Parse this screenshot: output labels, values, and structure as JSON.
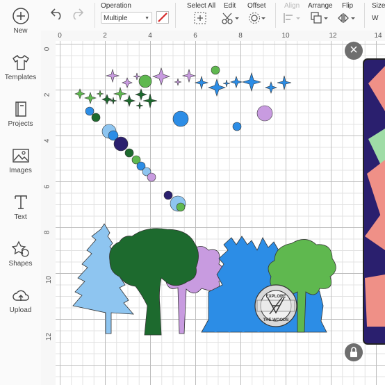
{
  "sidebar": {
    "items": [
      {
        "label": "New",
        "icon": "plus-circle-icon"
      },
      {
        "label": "Templates",
        "icon": "tshirt-icon"
      },
      {
        "label": "Projects",
        "icon": "book-icon"
      },
      {
        "label": "Images",
        "icon": "image-icon"
      },
      {
        "label": "Text",
        "icon": "text-t-icon"
      },
      {
        "label": "Shapes",
        "icon": "shapes-icon"
      },
      {
        "label": "Upload",
        "icon": "cloud-upload-icon"
      }
    ]
  },
  "toolbar": {
    "operation_label": "Operation",
    "operation_value": "Multiple",
    "select_all_label": "Select All",
    "edit_label": "Edit",
    "offset_label": "Offset",
    "align_label": "Align",
    "arrange_label": "Arrange",
    "flip_label": "Flip",
    "size_label": "Size",
    "size_w_label": "W"
  },
  "rulers": {
    "top": [
      "0",
      "2",
      "4",
      "6",
      "8",
      "10",
      "12",
      "14"
    ],
    "left": [
      "0",
      "2",
      "4",
      "6",
      "8",
      "10",
      "12"
    ]
  },
  "canvas": {
    "badge_line1": "EXPLORE",
    "badge_line2": "THE WOODS",
    "colors": {
      "light_blue": "#8ec5f0",
      "blue": "#2c8de6",
      "dark_green": "#1d6a2e",
      "green": "#5fb84f",
      "lavender": "#c89be0",
      "navy": "#2a1f6e",
      "salmon": "#ef9087",
      "mint": "#9fdca6"
    }
  }
}
